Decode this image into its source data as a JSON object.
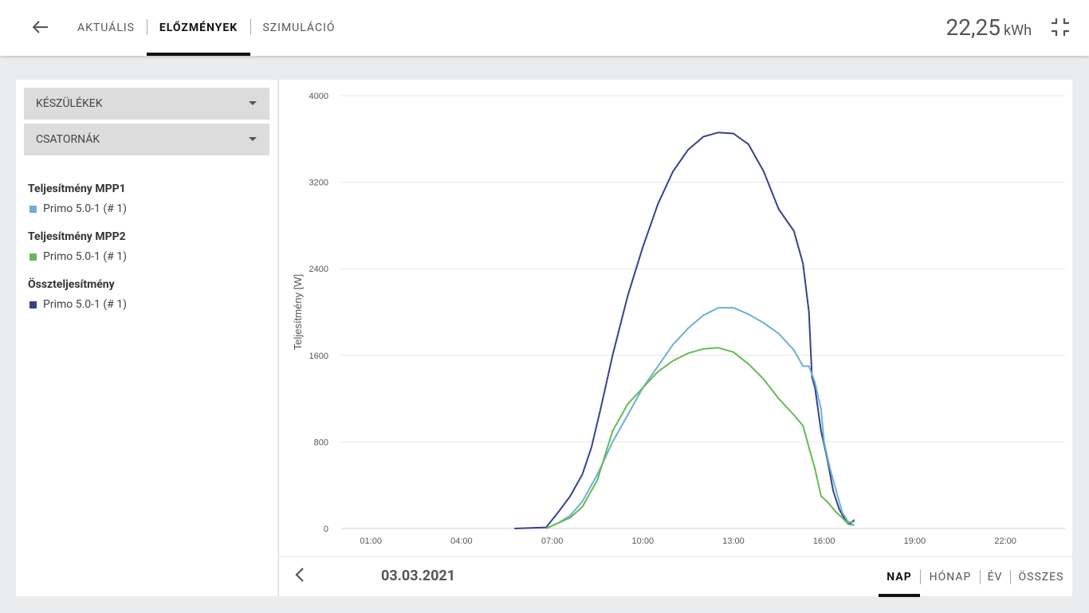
{
  "header": {
    "tabs": [
      {
        "label": "AKTUÁLIS",
        "active": false
      },
      {
        "label": "ELŐZMÉNYEK",
        "active": true
      },
      {
        "label": "SZIMULÁCIÓ",
        "active": false
      }
    ],
    "energy_value": "22,25",
    "energy_unit": "kWh"
  },
  "sidebar": {
    "dropdowns": [
      {
        "label": "KÉSZÜLÉKEK"
      },
      {
        "label": "CSATORNÁK"
      }
    ],
    "legend": [
      {
        "title": "Teljesítmény MPP1",
        "item": "Primo 5.0-1 (# 1)",
        "color": "#6cb0d6"
      },
      {
        "title": "Teljesítmény MPP2",
        "item": "Primo 5.0-1 (# 1)",
        "color": "#63bb52"
      },
      {
        "title": "Összteljesítmény",
        "item": "Primo 5.0-1 (# 1)",
        "color": "#37418d"
      }
    ]
  },
  "footer": {
    "date": "03.03.2021",
    "periods": [
      {
        "label": "NAP",
        "active": true
      },
      {
        "label": "HÓNAP",
        "active": false
      },
      {
        "label": "ÉV",
        "active": false
      },
      {
        "label": "ÖSSZES",
        "active": false
      }
    ]
  },
  "chart_data": {
    "type": "line",
    "ylabel": "Teljesítmény [W]",
    "xlabel": "",
    "ylim": [
      0,
      4000
    ],
    "yticks": [
      "0",
      "800",
      "1600",
      "2400",
      "3200",
      "4000"
    ],
    "xticks": [
      "01:00",
      "04:00",
      "07:00",
      "10:00",
      "13:00",
      "16:00",
      "19:00",
      "22:00"
    ],
    "xlim_hours": [
      0,
      24
    ],
    "grid": true,
    "series": [
      {
        "name": "Összteljesítmény",
        "color": "#37418d",
        "points": [
          [
            5.75,
            0
          ],
          [
            6.8,
            10
          ],
          [
            7.2,
            150
          ],
          [
            7.6,
            300
          ],
          [
            8.0,
            500
          ],
          [
            8.3,
            750
          ],
          [
            8.6,
            1100
          ],
          [
            9.0,
            1600
          ],
          [
            9.5,
            2150
          ],
          [
            10.0,
            2600
          ],
          [
            10.5,
            3000
          ],
          [
            11.0,
            3300
          ],
          [
            11.5,
            3500
          ],
          [
            12.0,
            3620
          ],
          [
            12.5,
            3660
          ],
          [
            13.0,
            3650
          ],
          [
            13.5,
            3550
          ],
          [
            14.0,
            3300
          ],
          [
            14.5,
            2950
          ],
          [
            15.0,
            2750
          ],
          [
            15.3,
            2450
          ],
          [
            15.5,
            2000
          ],
          [
            15.6,
            1400
          ],
          [
            15.7,
            1300
          ],
          [
            15.9,
            900
          ],
          [
            16.1,
            650
          ],
          [
            16.3,
            350
          ],
          [
            16.5,
            180
          ],
          [
            16.7,
            80
          ],
          [
            16.85,
            40
          ],
          [
            17.0,
            80
          ]
        ]
      },
      {
        "name": "Teljesítmény MPP1",
        "color": "#6cb0d6",
        "points": [
          [
            6.8,
            0
          ],
          [
            7.2,
            50
          ],
          [
            7.6,
            120
          ],
          [
            8.0,
            250
          ],
          [
            8.5,
            500
          ],
          [
            9.0,
            800
          ],
          [
            9.5,
            1050
          ],
          [
            10.0,
            1300
          ],
          [
            10.5,
            1500
          ],
          [
            11.0,
            1700
          ],
          [
            11.5,
            1850
          ],
          [
            12.0,
            1970
          ],
          [
            12.5,
            2040
          ],
          [
            13.0,
            2040
          ],
          [
            13.5,
            1980
          ],
          [
            14.0,
            1900
          ],
          [
            14.5,
            1800
          ],
          [
            15.0,
            1650
          ],
          [
            15.3,
            1500
          ],
          [
            15.5,
            1500
          ],
          [
            15.7,
            1350
          ],
          [
            15.9,
            1100
          ],
          [
            16.0,
            800
          ],
          [
            16.2,
            550
          ],
          [
            16.4,
            350
          ],
          [
            16.6,
            150
          ],
          [
            16.8,
            60
          ],
          [
            17.0,
            60
          ]
        ]
      },
      {
        "name": "Teljesítmény MPP2",
        "color": "#63bb52",
        "points": [
          [
            6.8,
            0
          ],
          [
            7.2,
            50
          ],
          [
            7.6,
            100
          ],
          [
            8.0,
            200
          ],
          [
            8.5,
            450
          ],
          [
            9.0,
            900
          ],
          [
            9.5,
            1150
          ],
          [
            10.0,
            1300
          ],
          [
            10.5,
            1450
          ],
          [
            11.0,
            1550
          ],
          [
            11.5,
            1620
          ],
          [
            12.0,
            1660
          ],
          [
            12.5,
            1670
          ],
          [
            13.0,
            1630
          ],
          [
            13.5,
            1520
          ],
          [
            14.0,
            1380
          ],
          [
            14.5,
            1200
          ],
          [
            15.0,
            1050
          ],
          [
            15.3,
            950
          ],
          [
            15.5,
            750
          ],
          [
            15.7,
            550
          ],
          [
            15.9,
            300
          ],
          [
            16.1,
            250
          ],
          [
            16.4,
            150
          ],
          [
            16.6,
            100
          ],
          [
            16.8,
            40
          ],
          [
            17.0,
            30
          ]
        ]
      }
    ]
  }
}
